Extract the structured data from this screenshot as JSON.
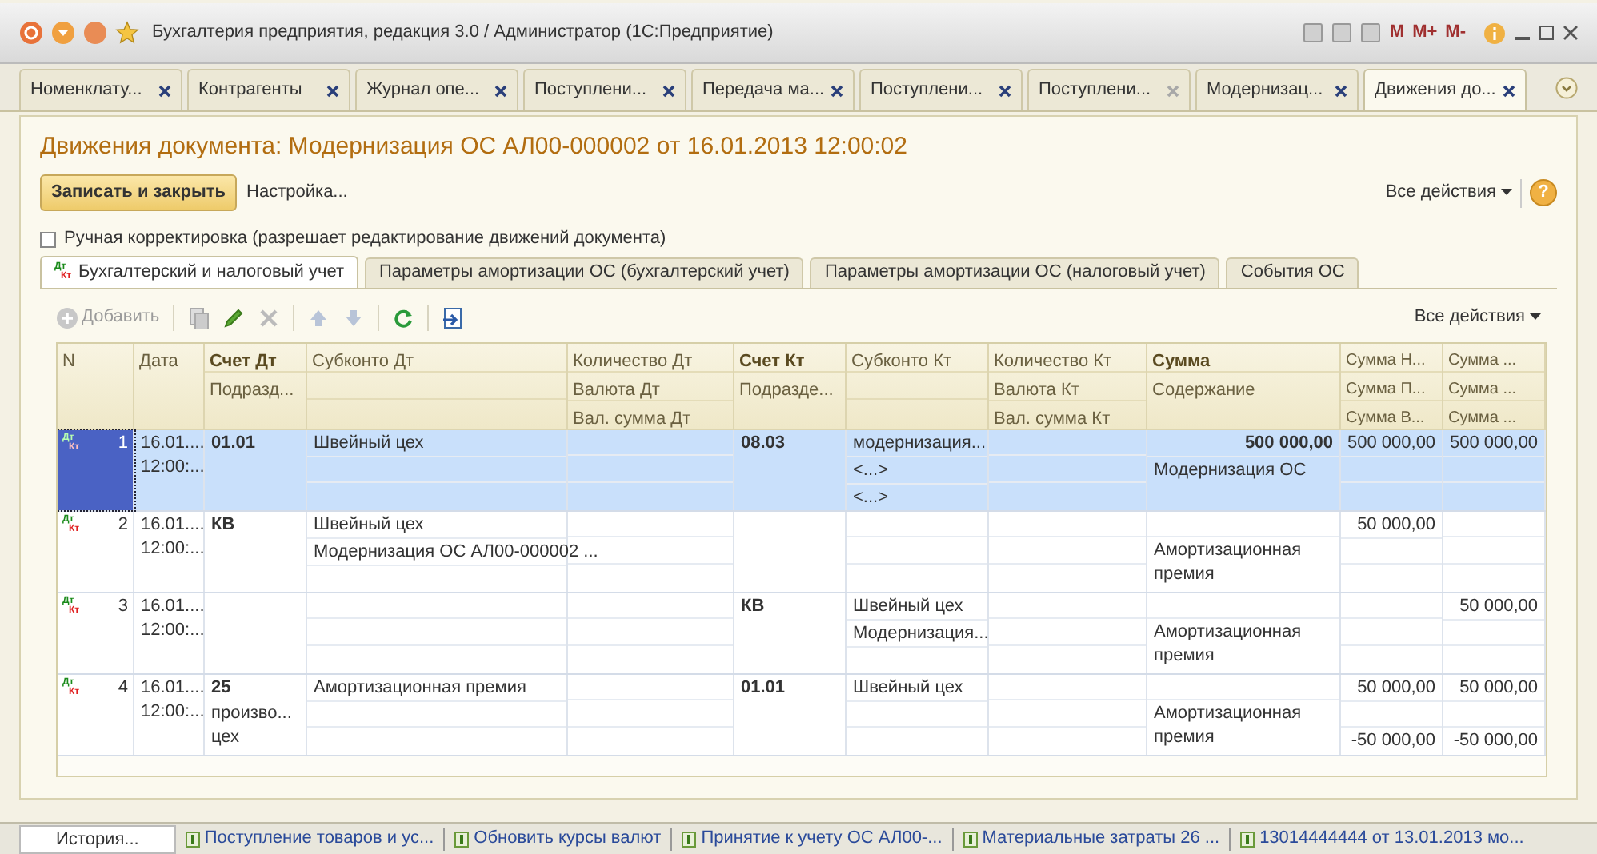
{
  "window": {
    "title": "Бухгалтерия предприятия, редакция 3.0 / Администратор  (1С:Предприятие)",
    "memory_buttons": [
      "M",
      "M+",
      "M-"
    ]
  },
  "open_tabs": [
    {
      "label": "Номенклату...",
      "selected": false,
      "close_enabled": true
    },
    {
      "label": "Контрагенты",
      "selected": false,
      "close_enabled": true
    },
    {
      "label": "Журнал опе...",
      "selected": false,
      "close_enabled": true
    },
    {
      "label": "Поступлени...",
      "selected": false,
      "close_enabled": true
    },
    {
      "label": "Передача ма...",
      "selected": false,
      "close_enabled": true
    },
    {
      "label": "Поступлени...",
      "selected": false,
      "close_enabled": true
    },
    {
      "label": "Поступлени...",
      "selected": false,
      "close_enabled": false
    },
    {
      "label": "Модернизац...",
      "selected": false,
      "close_enabled": true
    },
    {
      "label": "Движения до...",
      "selected": true,
      "close_enabled": true
    }
  ],
  "form": {
    "title": "Движения документа: Модернизация ОС АЛ00-000002 от 16.01.2013 12:00:02",
    "save_button": "Записать и закрыть",
    "settings_link": "Настройка...",
    "all_actions": "Все действия",
    "help": "?",
    "manual_edit": {
      "label": "Ручная корректировка (разрешает редактирование движений документа)",
      "checked": false
    },
    "tabs": [
      {
        "label": "Бухгалтерский и налоговый учет",
        "selected": true,
        "marks": [
          "Дт",
          "Кт"
        ]
      },
      {
        "label": "Параметры амортизации ОС (бухгалтерский учет)",
        "selected": false
      },
      {
        "label": "Параметры амортизации ОС (налоговый учет)",
        "selected": false
      },
      {
        "label": "События ОС",
        "selected": false
      }
    ],
    "toolbar": {
      "add": {
        "label": "Добавить",
        "disabled": true
      },
      "all_actions": "Все действия"
    }
  },
  "table": {
    "columns": [
      {
        "kind": "number",
        "bold": false,
        "header": [
          "N"
        ]
      },
      {
        "kind": "date",
        "bold": false,
        "header": [
          "Дата"
        ]
      },
      {
        "kind": "account",
        "bold": true,
        "header": [
          "Счет Дт",
          "Подразд..."
        ]
      },
      {
        "kind": "lines",
        "bold": false,
        "header": [
          "Субконто Дт"
        ]
      },
      {
        "kind": "lines",
        "bold": false,
        "header": [
          "Количество Дт",
          "Валюта Дт",
          "Вал. сумма Дт"
        ]
      },
      {
        "kind": "account",
        "bold": true,
        "header": [
          "Счет Кт",
          "Подразде..."
        ]
      },
      {
        "kind": "lines",
        "bold": false,
        "header": [
          "Субконто Кт"
        ]
      },
      {
        "kind": "lines",
        "bold": false,
        "header": [
          "Количество Кт",
          "Валюта Кт",
          "Вал. сумма Кт"
        ]
      },
      {
        "kind": "amount",
        "bold": true,
        "header": [
          "Сумма",
          "Содержание"
        ]
      },
      {
        "kind": "numeric",
        "bold": false,
        "header": [
          "Сумма Н...",
          "Сумма П...",
          "Сумма В..."
        ]
      },
      {
        "kind": "numeric",
        "bold": false,
        "header": [
          "Сумма ...",
          "Сумма ...",
          "Сумма ..."
        ]
      }
    ],
    "rows": [
      {
        "selected": true,
        "marks": [
          "Дт",
          "Кт"
        ],
        "cells": [
          [
            "1"
          ],
          [
            "16.01....",
            "12:00:..."
          ],
          [
            "01.01"
          ],
          [
            "Швейный цех",
            null,
            null
          ],
          [
            null,
            null,
            null
          ],
          [
            "08.03"
          ],
          [
            "модернизация...",
            "<...>",
            "<...>"
          ],
          [
            null,
            null,
            null
          ],
          [
            "500 000,00",
            "Модернизация ОС"
          ],
          [
            "500 000,00",
            null,
            null
          ],
          [
            "500 000,00",
            null,
            null
          ]
        ]
      },
      {
        "selected": false,
        "marks": [
          "Дт",
          "Кт"
        ],
        "cells": [
          [
            "2"
          ],
          [
            "16.01....",
            "12:00:..."
          ],
          [
            "КВ"
          ],
          [
            "Швейный цех",
            "Модернизация ОС АЛ00-000002 ...",
            null
          ],
          [
            null,
            null,
            null
          ],
          [
            null
          ],
          [
            null,
            null,
            null
          ],
          [
            null,
            null,
            null
          ],
          [
            null,
            "Амортизационная премия"
          ],
          [
            "50 000,00",
            null,
            null
          ],
          [
            null,
            null,
            null
          ]
        ]
      },
      {
        "selected": false,
        "marks": [
          "Дт",
          "Кт"
        ],
        "cells": [
          [
            "3"
          ],
          [
            "16.01....",
            "12:00:..."
          ],
          [
            null
          ],
          [
            null,
            null,
            null
          ],
          [
            null,
            null,
            null
          ],
          [
            "КВ"
          ],
          [
            "Швейный цех",
            "Модернизация...",
            null
          ],
          [
            null,
            null,
            null
          ],
          [
            null,
            "Амортизационная премия"
          ],
          [
            null,
            null,
            null
          ],
          [
            "50 000,00",
            null,
            null
          ]
        ]
      },
      {
        "selected": false,
        "marks": [
          "Дт",
          "Кт"
        ],
        "cells": [
          [
            "4"
          ],
          [
            "16.01....",
            "12:00:..."
          ],
          [
            "25",
            "произво... цех"
          ],
          [
            "Амортизационная премия",
            null,
            null
          ],
          [
            null,
            null,
            null
          ],
          [
            "01.01"
          ],
          [
            "Швейный цех",
            null,
            null
          ],
          [
            null,
            null,
            null
          ],
          [
            null,
            "Амортизационная премия"
          ],
          [
            "50 000,00",
            null,
            "-50 000,00"
          ],
          [
            "50 000,00",
            null,
            "-50 000,00"
          ]
        ]
      }
    ]
  },
  "taskbar": {
    "history": "История...",
    "items": [
      "Поступление товаров и ус...",
      "Обновить курсы валют",
      "Принятие к учету ОС АЛ00-...",
      "Материальные затраты 26 ...",
      "13014444444 от 13.01.2013 мо..."
    ]
  }
}
